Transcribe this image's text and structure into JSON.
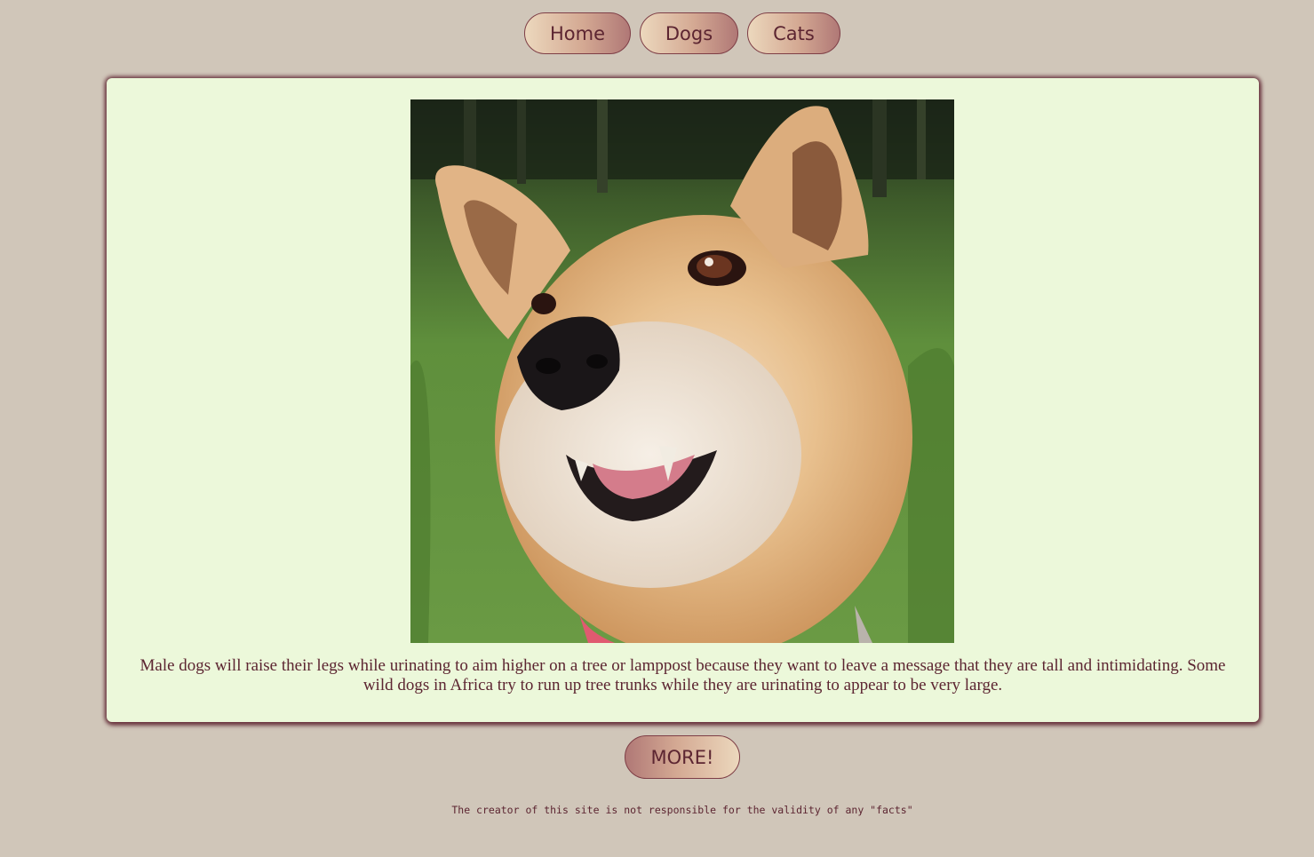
{
  "nav": {
    "home_label": "Home",
    "dogs_label": "Dogs",
    "cats_label": "Cats"
  },
  "content": {
    "fact_text": "Male dogs will raise their legs while urinating to aim higher on a tree or lamppost because they want to leave a message that they are tall and intimidating. Some wild dogs in Africa try to run up tree trunks while they are urinating to appear to be very large."
  },
  "more_label": "MORE!",
  "footer": {
    "disclaimer": "The creator of this site is not responsible for the validity of any \"facts\""
  },
  "colors": {
    "page_background": "#d0c6b9",
    "card_background": "#ecf8da",
    "text": "#5c2531",
    "button_border": "#7e3e46"
  }
}
